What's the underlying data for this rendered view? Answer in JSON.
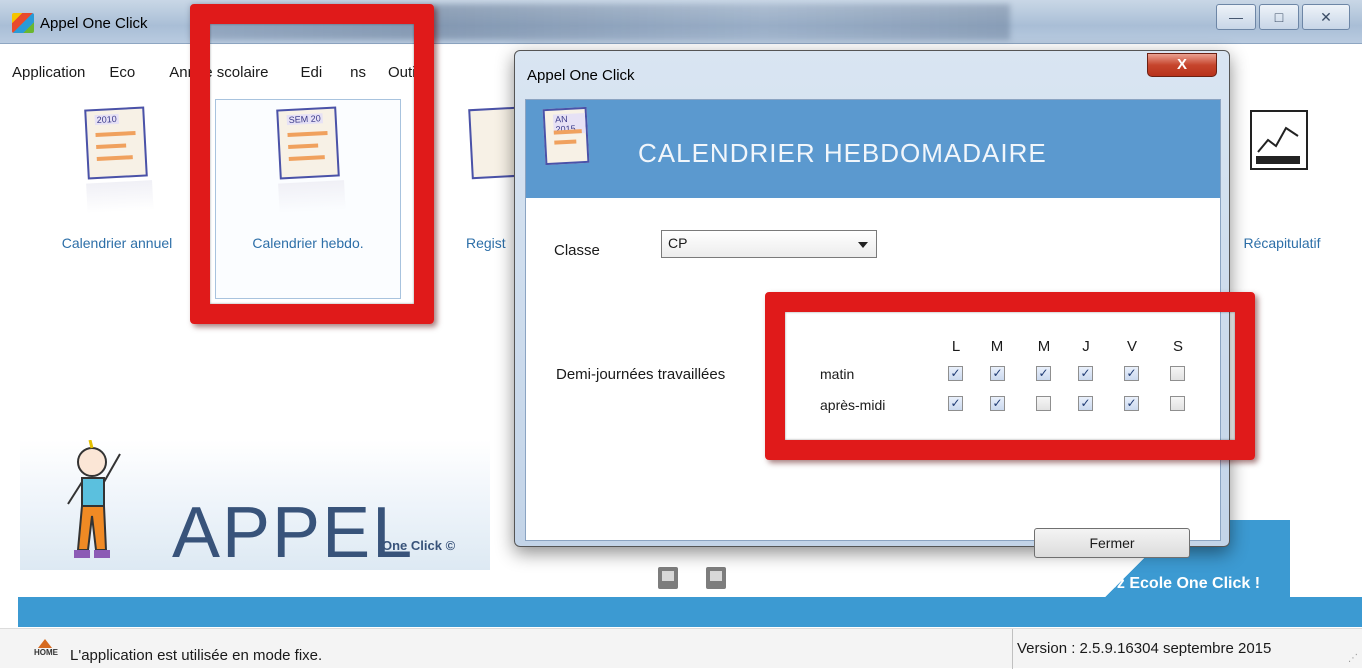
{
  "window": {
    "title": "Appel One Click",
    "minimize_glyph": "—",
    "restore_glyph": "□",
    "close_glyph": "✕"
  },
  "menu": [
    {
      "label": "Application"
    },
    {
      "label": "Eco"
    },
    {
      "label": "Année scolaire"
    },
    {
      "label": "Edi"
    },
    {
      "label": "ns"
    },
    {
      "label": "Outi"
    }
  ],
  "toolbar": {
    "annual": {
      "label": "Calendrier annuel",
      "tag": "2010"
    },
    "weekly": {
      "label": "Calendrier hebdo.",
      "tag": "SEM 20"
    },
    "register": {
      "label": "Regist"
    },
    "recap": {
      "label": "Récapitulatif"
    }
  },
  "logo": {
    "text": "APPEL",
    "sub": "One Click ©"
  },
  "promo": {
    "text": "...enez Ecole One Click !"
  },
  "status": {
    "message": "L'application est utilisée en mode fixe.",
    "home_badge": "HOME",
    "version": "Version : 2.5.9.1630",
    "date": "4 septembre 2015"
  },
  "dialog": {
    "title": "Appel One Click",
    "close_glyph": "X",
    "header_tag": "AN 2015",
    "header_title": "CALENDRIER HEBDOMADAIRE",
    "classe_label": "Classe",
    "classe_value": "CP",
    "demi_label": "Demi-journées travaillées",
    "days": [
      "L",
      "M",
      "M",
      "J",
      "V",
      "S"
    ],
    "rows": [
      {
        "label": "matin",
        "checked": [
          true,
          true,
          true,
          true,
          true,
          false
        ]
      },
      {
        "label": "après-midi",
        "checked": [
          true,
          true,
          false,
          true,
          true,
          false
        ]
      }
    ],
    "fermer_label": "Fermer"
  },
  "colors": {
    "accent_blue": "#5b99cf",
    "band_blue": "#3c9ad2",
    "annotation_red": "#e01a1a",
    "link_blue": "#2d6fa8"
  }
}
